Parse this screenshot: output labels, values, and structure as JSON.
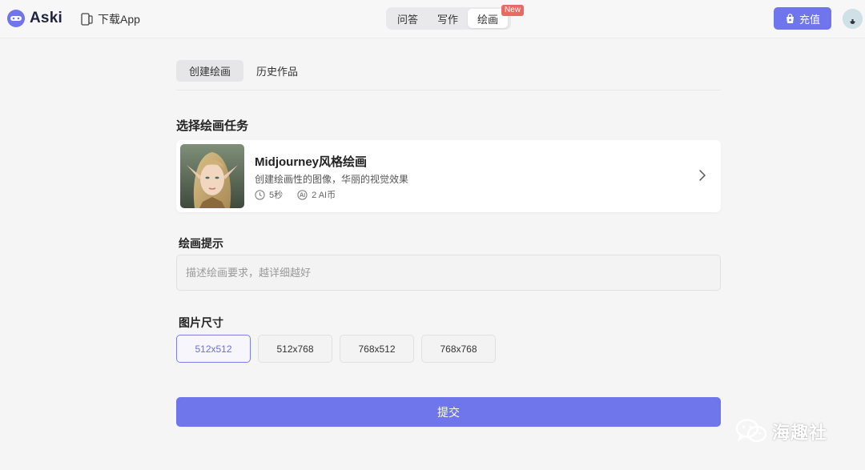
{
  "header": {
    "logo_text": "Aski",
    "download_label": "下载App",
    "mode_tabs": [
      {
        "label": "问答",
        "active": false
      },
      {
        "label": "写作",
        "active": false
      },
      {
        "label": "绘画",
        "active": true
      }
    ],
    "new_badge": "New",
    "recharge_label": "充值"
  },
  "sub_tabs": [
    {
      "label": "创建绘画",
      "active": true
    },
    {
      "label": "历史作品",
      "active": false
    }
  ],
  "task_section": {
    "title": "选择绘画任务",
    "card": {
      "name": "Midjourney风格绘画",
      "description": "创建绘画性的图像，华丽的视觉效果",
      "time": "5秒",
      "cost": "2 AI币"
    }
  },
  "prompt": {
    "label": "绘画提示",
    "placeholder": "描述绘画要求，越详细越好",
    "value": ""
  },
  "size": {
    "label": "图片尺寸",
    "options": [
      "512x512",
      "512x768",
      "768x512",
      "768x768"
    ],
    "selected": "512x512"
  },
  "submit_label": "提交",
  "watermark": "海趣社",
  "colors": {
    "accent": "#6f76ec",
    "badge": "#e86a62",
    "background": "#f5f5f6"
  }
}
